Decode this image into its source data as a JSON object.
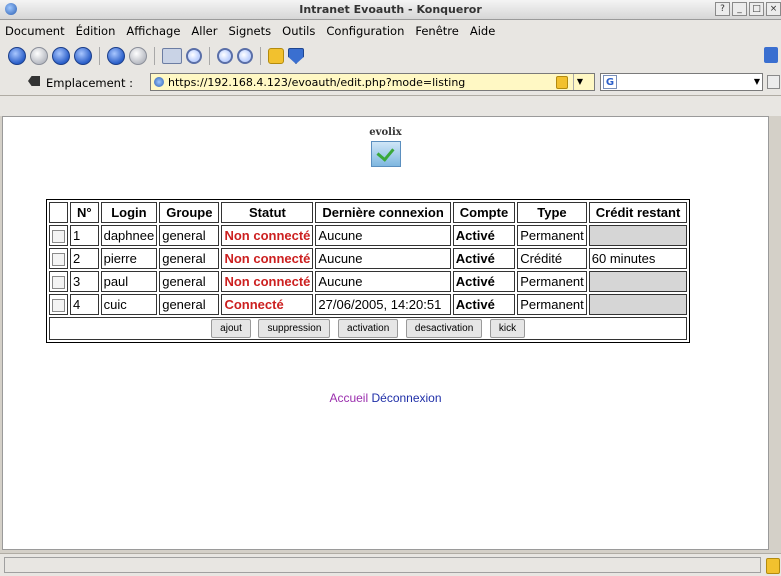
{
  "window": {
    "title": "Intranet Evoauth - Konqueror",
    "help_btn": "?",
    "min_btn": "_",
    "max_btn": "□",
    "close_btn": "×"
  },
  "menu": [
    "Document",
    "Édition",
    "Affichage",
    "Aller",
    "Signets",
    "Outils",
    "Configuration",
    "Fenêtre",
    "Aide"
  ],
  "toolbar": {
    "icons": [
      "back-icon",
      "forward-icon",
      "up-icon",
      "home-icon",
      "reload-icon",
      "stop-icon",
      "print-icon",
      "find-icon",
      "zoom-in-icon",
      "zoom-out-icon",
      "security-lock-icon",
      "download-icon"
    ]
  },
  "location": {
    "label": "Emplacement :",
    "url": "https://192.168.4.123/evoauth/edit.php?mode=listing",
    "search_glyph": "G"
  },
  "page": {
    "logo_text": "evolix",
    "table": {
      "headers": [
        "",
        "N°",
        "Login",
        "Groupe",
        "Statut",
        "Dernière connexion",
        "Compte",
        "Type",
        "Crédit restant"
      ],
      "rows": [
        {
          "num": "1",
          "login": "daphnee",
          "groupe": "general",
          "statut": "Non connecté",
          "derniere": "Aucune",
          "compte": "Activé",
          "type": "Permanent",
          "credit": ""
        },
        {
          "num": "2",
          "login": "pierre",
          "groupe": "general",
          "statut": "Non connecté",
          "derniere": "Aucune",
          "compte": "Activé",
          "type": "Crédité",
          "credit": "60 minutes"
        },
        {
          "num": "3",
          "login": "paul",
          "groupe": "general",
          "statut": "Non connecté",
          "derniere": "Aucune",
          "compte": "Activé",
          "type": "Permanent",
          "credit": ""
        },
        {
          "num": "4",
          "login": "cuic",
          "groupe": "general",
          "statut": "Connecté",
          "derniere": "27/06/2005, 14:20:51",
          "compte": "Activé",
          "type": "Permanent",
          "credit": ""
        }
      ],
      "buttons": [
        "ajout",
        "suppression",
        "activation",
        "desactivation",
        "kick"
      ]
    },
    "links": {
      "accueil": "Accueil",
      "deconnexion": "Déconnexion"
    }
  },
  "colors": {
    "status_red": "#cc1f1f",
    "link_accueil": "#9b2fae",
    "link_deconnexion": "#1f2fa8",
    "url_bg": "#fff8c4"
  }
}
